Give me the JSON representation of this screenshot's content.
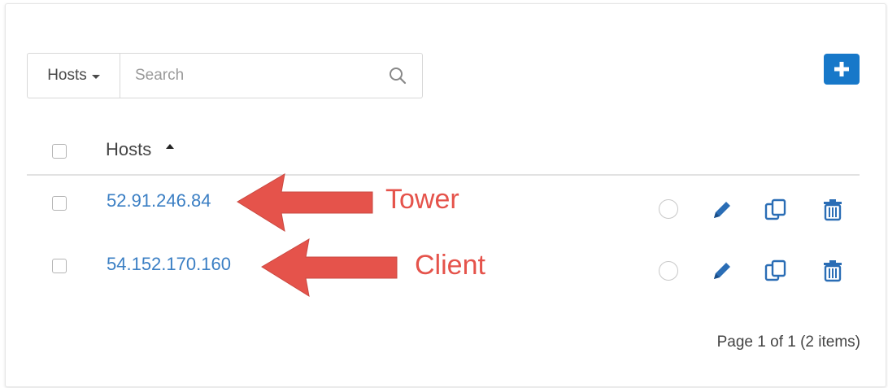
{
  "search": {
    "filter_label": "Hosts",
    "placeholder": "Search",
    "value": ""
  },
  "table": {
    "column_header": "Hosts",
    "sort": "ascending",
    "rows": [
      {
        "host": "52.91.246.84",
        "annotation": "Tower"
      },
      {
        "host": "54.152.170.160",
        "annotation": "Client"
      }
    ]
  },
  "pagination": {
    "text": "Page 1 of 1 (2 items)"
  },
  "icons": {
    "search": "search-icon",
    "add": "plus-icon",
    "edit": "pencil-icon",
    "copy": "copy-icon",
    "delete": "trash-icon"
  },
  "colors": {
    "accent": "#1778c9",
    "link": "#3b7fc4",
    "annotation": "#e5534b"
  }
}
